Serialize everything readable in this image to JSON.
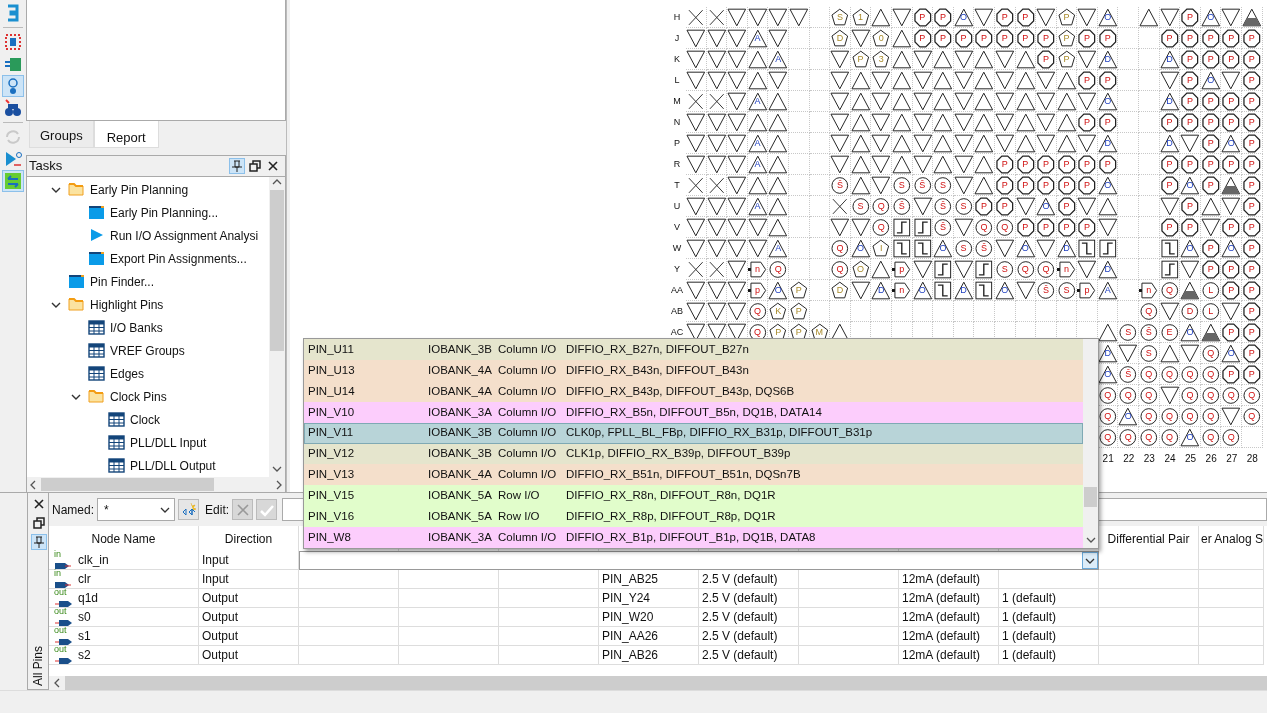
{
  "toolbar": [
    {
      "kind": "bracket",
      "selected": false,
      "disabled": false,
      "separated": false
    },
    {
      "kind": "dotted",
      "selected": false,
      "disabled": false,
      "separated": true
    },
    {
      "kind": "chip",
      "selected": false,
      "disabled": false,
      "separated": false
    },
    {
      "kind": "info",
      "selected": true,
      "disabled": false,
      "separated": false
    },
    {
      "kind": "binoculars",
      "selected": false,
      "disabled": false,
      "separated": false
    },
    {
      "kind": "refresh",
      "selected": false,
      "disabled": true,
      "separated": true
    },
    {
      "kind": "buffer",
      "selected": false,
      "disabled": false,
      "separated": false
    },
    {
      "kind": "swap",
      "selected": true,
      "disabled": false,
      "separated": false
    }
  ],
  "tabs": [
    {
      "label": "Groups",
      "selected": false
    },
    {
      "label": "Report",
      "selected": true
    }
  ],
  "tasks_panel": {
    "title": "Tasks",
    "header_buttons": [
      {
        "kind": "pin",
        "selected": true
      },
      {
        "kind": "restore",
        "selected": false
      },
      {
        "kind": "close",
        "selected": false
      }
    ],
    "tree": [
      {
        "kind": "folder",
        "label": "Early Pin Planning",
        "expanded": true,
        "children": [
          {
            "kind": "window",
            "label": "Early Pin Planning..."
          },
          {
            "kind": "run",
            "label": "Run I/O Assignment Analysi"
          },
          {
            "kind": "window",
            "label": "Export Pin Assignments..."
          }
        ]
      },
      {
        "kind": "window",
        "label": "Pin Finder..."
      },
      {
        "kind": "folder",
        "label": "Highlight Pins",
        "expanded": true,
        "children": [
          {
            "kind": "table",
            "label": "I/O Banks"
          },
          {
            "kind": "table",
            "label": "VREF Groups"
          },
          {
            "kind": "table",
            "label": "Edges"
          },
          {
            "kind": "folder",
            "label": "Clock Pins",
            "expanded": true,
            "children": [
              {
                "kind": "table",
                "label": "Clock"
              },
              {
                "kind": "table",
                "label": "PLL/DLL Input"
              },
              {
                "kind": "table",
                "label": "PLL/DLL Output"
              }
            ]
          }
        ]
      }
    ]
  },
  "package_view": {
    "rows": [
      {
        "label": "H",
        "cells": [
          {
            "kind": "cross"
          },
          {
            "kind": "cross"
          },
          {
            "kind": "down"
          },
          {
            "kind": "down"
          },
          {
            "kind": "down"
          },
          {
            "kind": "down"
          },
          {
            "kind": "empty"
          },
          {
            "kind": "pentagon",
            "code": "S"
          },
          {
            "kind": "pentagon",
            "code": "1"
          },
          {
            "kind": "up"
          },
          {
            "kind": "down"
          },
          {
            "kind": "octagon",
            "code": "P"
          },
          {
            "kind": "octagon",
            "code": "P"
          },
          {
            "kind": "up",
            "code": "O"
          },
          {
            "kind": "down"
          },
          {
            "kind": "octagon",
            "code": "P"
          },
          {
            "kind": "octagon",
            "code": "P"
          },
          {
            "kind": "down"
          },
          {
            "kind": "pentagon",
            "code": "P"
          },
          {
            "kind": "down"
          },
          {
            "kind": "up",
            "code": "O"
          },
          {
            "kind": "empty"
          },
          {
            "kind": "up"
          },
          {
            "kind": "down"
          },
          {
            "kind": "octagon",
            "code": "P"
          },
          {
            "kind": "up",
            "code": "O"
          },
          {
            "kind": "down"
          },
          {
            "kind": "shaded"
          }
        ]
      },
      {
        "label": "J",
        "cells": [
          {
            "kind": "down"
          },
          {
            "kind": "down"
          },
          {
            "kind": "down"
          },
          {
            "kind": "up",
            "code": "A"
          },
          {
            "kind": "down"
          },
          {
            "kind": "empty"
          },
          {
            "kind": "empty"
          },
          {
            "kind": "pentagon",
            "code": "D"
          },
          {
            "kind": "down"
          },
          {
            "kind": "pentagon",
            "code": "0"
          },
          {
            "kind": "up"
          },
          {
            "kind": "octagon",
            "code": "P"
          },
          {
            "kind": "octagon",
            "code": "P"
          },
          {
            "kind": "octagon",
            "code": "P"
          },
          {
            "kind": "octagon",
            "code": "P"
          },
          {
            "kind": "octagon",
            "code": "P"
          },
          {
            "kind": "octagon",
            "code": "P"
          },
          {
            "kind": "octagon",
            "code": "P"
          },
          {
            "kind": "pentagon",
            "code": "P"
          },
          {
            "kind": "octagon",
            "code": "P"
          },
          {
            "kind": "octagon",
            "code": "P"
          },
          {
            "kind": "empty"
          },
          {
            "kind": "empty"
          },
          {
            "kind": "octagon",
            "code": "P"
          },
          {
            "kind": "octagon",
            "code": "P"
          },
          {
            "kind": "octagon",
            "code": "P"
          },
          {
            "kind": "octagon",
            "code": "P"
          },
          {
            "kind": "octagon",
            "code": "P"
          }
        ]
      },
      {
        "label": "K",
        "cells": [
          {
            "kind": "down"
          },
          {
            "kind": "down"
          },
          {
            "kind": "down"
          },
          {
            "kind": "up"
          },
          {
            "kind": "up",
            "code": "A"
          },
          {
            "kind": "empty"
          },
          {
            "kind": "empty"
          },
          {
            "kind": "down"
          },
          {
            "kind": "pentagon",
            "code": "P"
          },
          {
            "kind": "pentagon",
            "code": "3"
          },
          {
            "kind": "up"
          },
          {
            "kind": "down"
          },
          {
            "kind": "up"
          },
          {
            "kind": "down"
          },
          {
            "kind": "up"
          },
          {
            "kind": "down"
          },
          {
            "kind": "up"
          },
          {
            "kind": "octagon",
            "code": "P"
          },
          {
            "kind": "pentagon",
            "code": "P"
          },
          {
            "kind": "down"
          },
          {
            "kind": "up",
            "code": "D"
          },
          {
            "kind": "empty"
          },
          {
            "kind": "empty"
          },
          {
            "kind": "up",
            "code": "D"
          },
          {
            "kind": "octagon",
            "code": "P"
          },
          {
            "kind": "octagon",
            "code": "P"
          },
          {
            "kind": "octagon",
            "code": "P"
          },
          {
            "kind": "octagon",
            "code": "P"
          }
        ]
      },
      {
        "label": "L",
        "cells": [
          {
            "kind": "down"
          },
          {
            "kind": "down"
          },
          {
            "kind": "down"
          },
          {
            "kind": "up"
          },
          {
            "kind": "down"
          },
          {
            "kind": "empty"
          },
          {
            "kind": "empty"
          },
          {
            "kind": "down"
          },
          {
            "kind": "up"
          },
          {
            "kind": "down"
          },
          {
            "kind": "up"
          },
          {
            "kind": "down"
          },
          {
            "kind": "up"
          },
          {
            "kind": "down"
          },
          {
            "kind": "up"
          },
          {
            "kind": "down"
          },
          {
            "kind": "up"
          },
          {
            "kind": "down"
          },
          {
            "kind": "up"
          },
          {
            "kind": "octagon",
            "code": "P"
          },
          {
            "kind": "octagon",
            "code": "P"
          },
          {
            "kind": "empty"
          },
          {
            "kind": "empty"
          },
          {
            "kind": "down"
          },
          {
            "kind": "octagon",
            "code": "P"
          },
          {
            "kind": "up",
            "code": "O"
          },
          {
            "kind": "down"
          },
          {
            "kind": "octagon",
            "code": "P"
          }
        ]
      },
      {
        "label": "M",
        "cells": [
          {
            "kind": "cross"
          },
          {
            "kind": "cross"
          },
          {
            "kind": "down"
          },
          {
            "kind": "up",
            "code": "A"
          },
          {
            "kind": "up"
          },
          {
            "kind": "empty"
          },
          {
            "kind": "empty"
          },
          {
            "kind": "down"
          },
          {
            "kind": "up"
          },
          {
            "kind": "down"
          },
          {
            "kind": "up"
          },
          {
            "kind": "down"
          },
          {
            "kind": "up"
          },
          {
            "kind": "down"
          },
          {
            "kind": "up"
          },
          {
            "kind": "down"
          },
          {
            "kind": "up"
          },
          {
            "kind": "down"
          },
          {
            "kind": "up"
          },
          {
            "kind": "down"
          },
          {
            "kind": "up",
            "code": "O"
          },
          {
            "kind": "empty"
          },
          {
            "kind": "empty"
          },
          {
            "kind": "up",
            "code": "D"
          },
          {
            "kind": "octagon",
            "code": "P"
          },
          {
            "kind": "octagon",
            "code": "P"
          },
          {
            "kind": "octagon",
            "code": "P"
          },
          {
            "kind": "octagon",
            "code": "P"
          }
        ]
      },
      {
        "label": "N",
        "cells": [
          {
            "kind": "down"
          },
          {
            "kind": "down"
          },
          {
            "kind": "down"
          },
          {
            "kind": "up"
          },
          {
            "kind": "up"
          },
          {
            "kind": "empty"
          },
          {
            "kind": "empty"
          },
          {
            "kind": "down"
          },
          {
            "kind": "up"
          },
          {
            "kind": "down"
          },
          {
            "kind": "up"
          },
          {
            "kind": "down"
          },
          {
            "kind": "up"
          },
          {
            "kind": "down"
          },
          {
            "kind": "up"
          },
          {
            "kind": "down"
          },
          {
            "kind": "up"
          },
          {
            "kind": "down"
          },
          {
            "kind": "up"
          },
          {
            "kind": "octagon",
            "code": "P"
          },
          {
            "kind": "octagon",
            "code": "P"
          },
          {
            "kind": "empty"
          },
          {
            "kind": "empty"
          },
          {
            "kind": "octagon",
            "code": "P"
          },
          {
            "kind": "octagon",
            "code": "P"
          },
          {
            "kind": "octagon",
            "code": "P"
          },
          {
            "kind": "octagon",
            "code": "P"
          },
          {
            "kind": "octagon",
            "code": "P"
          }
        ]
      },
      {
        "label": "P",
        "cells": [
          {
            "kind": "down"
          },
          {
            "kind": "down"
          },
          {
            "kind": "down"
          },
          {
            "kind": "up",
            "code": "A"
          },
          {
            "kind": "up"
          },
          {
            "kind": "empty"
          },
          {
            "kind": "empty"
          },
          {
            "kind": "down"
          },
          {
            "kind": "up"
          },
          {
            "kind": "down"
          },
          {
            "kind": "up"
          },
          {
            "kind": "down"
          },
          {
            "kind": "up"
          },
          {
            "kind": "down"
          },
          {
            "kind": "up"
          },
          {
            "kind": "down"
          },
          {
            "kind": "up"
          },
          {
            "kind": "down"
          },
          {
            "kind": "up"
          },
          {
            "kind": "down"
          },
          {
            "kind": "up",
            "code": "D"
          },
          {
            "kind": "empty"
          },
          {
            "kind": "empty"
          },
          {
            "kind": "up",
            "code": "D"
          },
          {
            "kind": "down"
          },
          {
            "kind": "octagon",
            "code": "P"
          },
          {
            "kind": "up",
            "code": "O"
          },
          {
            "kind": "octagon",
            "code": "P"
          }
        ]
      },
      {
        "label": "R",
        "cells": [
          {
            "kind": "down"
          },
          {
            "kind": "down"
          },
          {
            "kind": "down"
          },
          {
            "kind": "up",
            "code": "A"
          },
          {
            "kind": "up"
          },
          {
            "kind": "empty"
          },
          {
            "kind": "empty"
          },
          {
            "kind": "down"
          },
          {
            "kind": "up"
          },
          {
            "kind": "down"
          },
          {
            "kind": "up"
          },
          {
            "kind": "down"
          },
          {
            "kind": "up"
          },
          {
            "kind": "down"
          },
          {
            "kind": "up"
          },
          {
            "kind": "octagon",
            "code": "P"
          },
          {
            "kind": "octagon",
            "code": "P"
          },
          {
            "kind": "octagon",
            "code": "P"
          },
          {
            "kind": "octagon",
            "code": "P"
          },
          {
            "kind": "octagon",
            "code": "P"
          },
          {
            "kind": "octagon",
            "code": "P"
          },
          {
            "kind": "empty"
          },
          {
            "kind": "empty"
          },
          {
            "kind": "octagon",
            "code": "P"
          },
          {
            "kind": "octagon",
            "code": "P"
          },
          {
            "kind": "octagon",
            "code": "P"
          },
          {
            "kind": "octagon",
            "code": "P"
          },
          {
            "kind": "octagon",
            "code": "P"
          }
        ]
      },
      {
        "label": "T",
        "cells": [
          {
            "kind": "cross"
          },
          {
            "kind": "cross"
          },
          {
            "kind": "down"
          },
          {
            "kind": "up"
          },
          {
            "kind": "up"
          },
          {
            "kind": "empty"
          },
          {
            "kind": "empty"
          },
          {
            "kind": "circle",
            "code": "Š"
          },
          {
            "kind": "up"
          },
          {
            "kind": "down"
          },
          {
            "kind": "circle",
            "code": "S"
          },
          {
            "kind": "circle",
            "code": "Š"
          },
          {
            "kind": "circle",
            "code": "S"
          },
          {
            "kind": "down"
          },
          {
            "kind": "up"
          },
          {
            "kind": "octagon",
            "code": "P"
          },
          {
            "kind": "octagon",
            "code": "P"
          },
          {
            "kind": "octagon",
            "code": "P"
          },
          {
            "kind": "octagon",
            "code": "P"
          },
          {
            "kind": "octagon",
            "code": "P"
          },
          {
            "kind": "up",
            "code": "O"
          },
          {
            "kind": "empty"
          },
          {
            "kind": "empty"
          },
          {
            "kind": "octagon",
            "code": "P"
          },
          {
            "kind": "up",
            "code": "O"
          },
          {
            "kind": "octagon",
            "code": "P"
          },
          {
            "kind": "shaded"
          },
          {
            "kind": "octagon",
            "code": "P"
          }
        ]
      },
      {
        "label": "U",
        "cells": [
          {
            "kind": "down"
          },
          {
            "kind": "down"
          },
          {
            "kind": "down"
          },
          {
            "kind": "up",
            "code": "A"
          },
          {
            "kind": "up"
          },
          {
            "kind": "empty"
          },
          {
            "kind": "empty"
          },
          {
            "kind": "cross"
          },
          {
            "kind": "circle",
            "code": "S"
          },
          {
            "kind": "circle",
            "code": "Q"
          },
          {
            "kind": "circle",
            "code": "Š"
          },
          {
            "kind": "down"
          },
          {
            "kind": "circle",
            "code": "Š"
          },
          {
            "kind": "circle",
            "code": "S"
          },
          {
            "kind": "octagon",
            "code": "P"
          },
          {
            "kind": "octagon",
            "code": "P"
          },
          {
            "kind": "down"
          },
          {
            "kind": "up",
            "code": "O"
          },
          {
            "kind": "octagon",
            "code": "P"
          },
          {
            "kind": "down"
          },
          {
            "kind": "up"
          },
          {
            "kind": "empty"
          },
          {
            "kind": "empty"
          },
          {
            "kind": "down"
          },
          {
            "kind": "octagon",
            "code": "P"
          },
          {
            "kind": "up"
          },
          {
            "kind": "down"
          },
          {
            "kind": "octagon",
            "code": "P"
          }
        ]
      },
      {
        "label": "V",
        "cells": [
          {
            "kind": "down"
          },
          {
            "kind": "down"
          },
          {
            "kind": "down"
          },
          {
            "kind": "down"
          },
          {
            "kind": "up"
          },
          {
            "kind": "empty"
          },
          {
            "kind": "empty"
          },
          {
            "kind": "down"
          },
          {
            "kind": "down"
          },
          {
            "kind": "circle",
            "code": "Q"
          },
          {
            "kind": "rise"
          },
          {
            "kind": "rise"
          },
          {
            "kind": "circle",
            "code": "Š"
          },
          {
            "kind": "down"
          },
          {
            "kind": "circle",
            "code": "Q"
          },
          {
            "kind": "circle",
            "code": "Q"
          },
          {
            "kind": "octagon",
            "code": "P"
          },
          {
            "kind": "octagon",
            "code": "P"
          },
          {
            "kind": "octagon",
            "code": "P"
          },
          {
            "kind": "octagon",
            "code": "P"
          },
          {
            "kind": "down"
          },
          {
            "kind": "empty"
          },
          {
            "kind": "empty"
          },
          {
            "kind": "octagon",
            "code": "P"
          },
          {
            "kind": "octagon",
            "code": "P"
          },
          {
            "kind": "down"
          },
          {
            "kind": "octagon",
            "code": "P"
          },
          {
            "kind": "octagon",
            "code": "P"
          }
        ]
      },
      {
        "label": "W",
        "cells": [
          {
            "kind": "down"
          },
          {
            "kind": "down"
          },
          {
            "kind": "down"
          },
          {
            "kind": "down"
          },
          {
            "kind": "up",
            "code": "A"
          },
          {
            "kind": "empty"
          },
          {
            "kind": "empty"
          },
          {
            "kind": "circle",
            "code": "Q"
          },
          {
            "kind": "up",
            "code": "O"
          },
          {
            "kind": "pentagon",
            "code": "I"
          },
          {
            "kind": "fall"
          },
          {
            "kind": "fall"
          },
          {
            "kind": "up",
            "code": "O"
          },
          {
            "kind": "circle",
            "code": "S"
          },
          {
            "kind": "circle",
            "code": "Š"
          },
          {
            "kind": "down"
          },
          {
            "kind": "up",
            "code": "O"
          },
          {
            "kind": "down"
          },
          {
            "kind": "up",
            "code": "D"
          },
          {
            "kind": "fall"
          },
          {
            "kind": "rise"
          },
          {
            "kind": "empty"
          },
          {
            "kind": "empty"
          },
          {
            "kind": "fall"
          },
          {
            "kind": "up",
            "code": "O"
          },
          {
            "kind": "octagon",
            "code": "P"
          },
          {
            "kind": "up",
            "code": "O"
          },
          {
            "kind": "octagon",
            "code": "P"
          }
        ]
      },
      {
        "label": "Y",
        "cells": [
          {
            "kind": "cross"
          },
          {
            "kind": "cross"
          },
          {
            "kind": "down"
          },
          {
            "kind": "flag",
            "code": "n"
          },
          {
            "kind": "circle",
            "code": "Q"
          },
          {
            "kind": "empty"
          },
          {
            "kind": "empty"
          },
          {
            "kind": "circle",
            "code": "Q"
          },
          {
            "kind": "pentagon",
            "code": "O"
          },
          {
            "kind": "up"
          },
          {
            "kind": "flag",
            "code": "p"
          },
          {
            "kind": "down"
          },
          {
            "kind": "rise"
          },
          {
            "kind": "down"
          },
          {
            "kind": "rise"
          },
          {
            "kind": "circle",
            "code": "S"
          },
          {
            "kind": "circle",
            "code": "Q"
          },
          {
            "kind": "circle",
            "code": "Q"
          },
          {
            "kind": "flag",
            "code": "n"
          },
          {
            "kind": "down"
          },
          {
            "kind": "up",
            "code": "D"
          },
          {
            "kind": "empty"
          },
          {
            "kind": "empty"
          },
          {
            "kind": "rise"
          },
          {
            "kind": "down"
          },
          {
            "kind": "octagon",
            "code": "P"
          },
          {
            "kind": "octagon",
            "code": "P"
          },
          {
            "kind": "octagon",
            "code": "P"
          }
        ]
      },
      {
        "label": "AA",
        "cells": [
          {
            "kind": "down"
          },
          {
            "kind": "down"
          },
          {
            "kind": "down"
          },
          {
            "kind": "flag",
            "code": "p"
          },
          {
            "kind": "up",
            "code": "O"
          },
          {
            "kind": "pentagon",
            "code": "P"
          },
          {
            "kind": "empty"
          },
          {
            "kind": "pentagon",
            "code": "D"
          },
          {
            "kind": "down"
          },
          {
            "kind": "up",
            "code": "D"
          },
          {
            "kind": "flag",
            "code": "n"
          },
          {
            "kind": "up",
            "code": "O"
          },
          {
            "kind": "fall"
          },
          {
            "kind": "up",
            "code": "D"
          },
          {
            "kind": "fall"
          },
          {
            "kind": "up",
            "code": "O"
          },
          {
            "kind": "down"
          },
          {
            "kind": "circle",
            "code": "Š"
          },
          {
            "kind": "circle",
            "code": "S"
          },
          {
            "kind": "flag",
            "code": "p"
          },
          {
            "kind": "up",
            "code": "A"
          },
          {
            "kind": "empty"
          },
          {
            "kind": "flag",
            "code": "n"
          },
          {
            "kind": "circle",
            "code": "Q"
          },
          {
            "kind": "shaded"
          },
          {
            "kind": "circle",
            "code": "L"
          },
          {
            "kind": "octagon",
            "code": "P"
          },
          {
            "kind": "octagon",
            "code": "P"
          }
        ]
      },
      {
        "label": "AB",
        "cells": [
          {
            "kind": "down"
          },
          {
            "kind": "down"
          },
          {
            "kind": "down"
          },
          {
            "kind": "circle",
            "code": "Q"
          },
          {
            "kind": "pentagon",
            "code": "K"
          },
          {
            "kind": "pentagon",
            "code": "P"
          },
          {
            "kind": "empty"
          },
          {
            "kind": "empty"
          },
          {
            "kind": "empty"
          },
          {
            "kind": "empty"
          },
          {
            "kind": "empty"
          },
          {
            "kind": "empty"
          },
          {
            "kind": "empty"
          },
          {
            "kind": "empty"
          },
          {
            "kind": "empty"
          },
          {
            "kind": "empty"
          },
          {
            "kind": "empty"
          },
          {
            "kind": "empty"
          },
          {
            "kind": "empty"
          },
          {
            "kind": "empty"
          },
          {
            "kind": "empty"
          },
          {
            "kind": "empty"
          },
          {
            "kind": "circle",
            "code": "Q"
          },
          {
            "kind": "down"
          },
          {
            "kind": "circle",
            "code": "D"
          },
          {
            "kind": "circle",
            "code": "L"
          },
          {
            "kind": "down"
          },
          {
            "kind": "octagon",
            "code": "P"
          }
        ]
      },
      {
        "label": "AC",
        "cells": [
          {
            "kind": "down"
          },
          {
            "kind": "down"
          },
          {
            "kind": "down"
          },
          {
            "kind": "circle",
            "code": "Q"
          },
          {
            "kind": "pentagon",
            "code": "P"
          },
          {
            "kind": "pentagon",
            "code": "P"
          },
          {
            "kind": "pentagon",
            "code": "M"
          },
          {
            "kind": "up"
          },
          {
            "kind": "empty"
          },
          {
            "kind": "empty"
          },
          {
            "kind": "empty"
          },
          {
            "kind": "empty"
          },
          {
            "kind": "empty"
          },
          {
            "kind": "empty"
          },
          {
            "kind": "empty"
          },
          {
            "kind": "empty"
          },
          {
            "kind": "empty"
          },
          {
            "kind": "empty"
          },
          {
            "kind": "empty"
          },
          {
            "kind": "empty"
          },
          {
            "kind": "up"
          },
          {
            "kind": "circle",
            "code": "S"
          },
          {
            "kind": "circle",
            "code": "Š"
          },
          {
            "kind": "circle",
            "code": "E"
          },
          {
            "kind": "up",
            "code": "O"
          },
          {
            "kind": "shaded"
          },
          {
            "kind": "octagon",
            "code": "P"
          },
          {
            "kind": "octagon",
            "code": "P"
          }
        ]
      },
      {
        "cells": [
          {
            "kind": "up",
            "code": "D"
          },
          {
            "kind": "down"
          },
          {
            "kind": "circle",
            "code": "S"
          },
          {
            "kind": "up"
          },
          {
            "kind": "down"
          },
          {
            "kind": "circle",
            "code": "Q"
          },
          {
            "kind": "up",
            "code": "O"
          },
          {
            "kind": "octagon",
            "code": "P"
          }
        ]
      },
      {
        "cells": [
          {
            "kind": "up",
            "code": "O"
          },
          {
            "kind": "circle",
            "code": "Š"
          },
          {
            "kind": "circle",
            "code": "Q"
          },
          {
            "kind": "circle",
            "code": "Q"
          },
          {
            "kind": "circle",
            "code": "Q"
          },
          {
            "kind": "circle",
            "code": "Q"
          },
          {
            "kind": "octagon",
            "code": "P"
          },
          {
            "kind": "octagon",
            "code": "P"
          }
        ]
      },
      {
        "cells": [
          {
            "kind": "circle",
            "code": "Q"
          },
          {
            "kind": "circle",
            "code": "Q"
          },
          {
            "kind": "circle",
            "code": "Q"
          },
          {
            "kind": "down"
          },
          {
            "kind": "circle",
            "code": "Q"
          },
          {
            "kind": "circle",
            "code": "Q"
          },
          {
            "kind": "circle",
            "code": "Q"
          },
          {
            "kind": "circle",
            "code": "Q"
          }
        ]
      },
      {
        "cells": [
          {
            "kind": "circle",
            "code": "Q"
          },
          {
            "kind": "up",
            "code": "O"
          },
          {
            "kind": "circle",
            "code": "Q"
          },
          {
            "kind": "circle",
            "code": "Q"
          },
          {
            "kind": "circle",
            "code": "Q"
          },
          {
            "kind": "circle",
            "code": "Q"
          },
          {
            "kind": "down"
          },
          {
            "kind": "circle",
            "code": "Q"
          }
        ]
      },
      {
        "cells": [
          {
            "kind": "circle",
            "code": "Q"
          },
          {
            "kind": "circle",
            "code": "Q"
          },
          {
            "kind": "circle",
            "code": "Q"
          },
          {
            "kind": "circle",
            "code": "Q"
          },
          {
            "kind": "up",
            "code": "O"
          },
          {
            "kind": "circle",
            "code": "Q"
          },
          {
            "kind": "circle",
            "code": "Q"
          },
          {
            "kind": "empty"
          }
        ]
      }
    ],
    "column_labels": [
      "21",
      "22",
      "23",
      "24",
      "25",
      "26",
      "27",
      "28"
    ]
  },
  "pins_panel": {
    "side_tab": "All Pins",
    "side_buttons": [
      {
        "kind": "close",
        "selected": false
      },
      {
        "kind": "restore",
        "selected": false
      },
      {
        "kind": "pin",
        "selected": true
      }
    ],
    "named_label": "Named:",
    "named_value": "*",
    "edit_label": "Edit:",
    "edit_buttons": [
      {
        "kind": "cancel",
        "disabled": true
      },
      {
        "kind": "accept",
        "disabled": true
      }
    ],
    "columns": [
      "Node Name",
      "Direction"
    ],
    "right_columns": [
      "Differential Pair",
      "er Analog S"
    ],
    "rows": [
      {
        "kind": "input",
        "tag": "in",
        "node_name": "clk_in",
        "direction": "Input",
        "editing": true
      },
      {
        "kind": "input",
        "tag": "in",
        "node_name": "clr",
        "direction": "Input",
        "editing": false,
        "column_6": "PIN_AB25",
        "column_7": "2.5 V (default)",
        "column_9": "12mA (default)"
      },
      {
        "kind": "output",
        "tag": "out",
        "node_name": "q1d",
        "direction": "Output",
        "editing": false,
        "column_6": "PIN_Y24",
        "column_7": "2.5 V (default)",
        "column_9": "12mA (default)",
        "column_10": "1 (default)"
      },
      {
        "kind": "output",
        "tag": "out",
        "node_name": "s0",
        "direction": "Output",
        "editing": false,
        "column_6": "PIN_W20",
        "column_7": "2.5 V (default)",
        "column_9": "12mA (default)",
        "column_10": "1 (default)"
      },
      {
        "kind": "output",
        "tag": "out",
        "node_name": "s1",
        "direction": "Output",
        "editing": false,
        "column_6": "PIN_AA26",
        "column_7": "2.5 V (default)",
        "column_9": "12mA (default)",
        "column_10": "1 (default)"
      },
      {
        "kind": "output",
        "tag": "out",
        "node_name": "s2",
        "direction": "Output",
        "editing": false,
        "column_6": "PIN_AB26",
        "column_7": "2.5 V (default)",
        "column_9": "12mA (default)",
        "column_10": "1 (default)"
      }
    ]
  },
  "location_dropdown": {
    "options": [
      {
        "pin": "PIN_U11",
        "bank": "IOBANK_3B",
        "type": "Column I/O",
        "functions": "DIFFIO_RX_B27n, DIFFOUT_B27n",
        "color": "#e5e5cd",
        "selected": false
      },
      {
        "pin": "PIN_U13",
        "bank": "IOBANK_4A",
        "type": "Column I/O",
        "functions": "DIFFIO_RX_B43n, DIFFOUT_B43n",
        "color": "#f4dfcb",
        "selected": false
      },
      {
        "pin": "PIN_U14",
        "bank": "IOBANK_4A",
        "type": "Column I/O",
        "functions": "DIFFIO_RX_B43p, DIFFOUT_B43p, DQS6B",
        "color": "#f4dfcb",
        "selected": false
      },
      {
        "pin": "PIN_V10",
        "bank": "IOBANK_3A",
        "type": "Column I/O",
        "functions": "DIFFIO_RX_B5n, DIFFOUT_B5n, DQ1B, DATA14",
        "color": "#fccdfc",
        "selected": false
      },
      {
        "pin": "PIN_V11",
        "bank": "IOBANK_3B",
        "type": "Column I/O",
        "functions": "CLK0p, FPLL_BL_FBp, DIFFIO_RX_B31p, DIFFOUT_B31p",
        "selected": true
      },
      {
        "pin": "PIN_V12",
        "bank": "IOBANK_3B",
        "type": "Column I/O",
        "functions": "CLK1p, DIFFIO_RX_B39p, DIFFOUT_B39p",
        "color": "#e5e5cd",
        "selected": false
      },
      {
        "pin": "PIN_V13",
        "bank": "IOBANK_4A",
        "type": "Column I/O",
        "functions": "DIFFIO_RX_B51n, DIFFOUT_B51n, DQSn7B",
        "color": "#f4dfcb",
        "selected": false
      },
      {
        "pin": "PIN_V15",
        "bank": "IOBANK_5A",
        "type": "Row I/O",
        "functions": "DIFFIO_RX_R8n, DIFFOUT_R8n, DQ1R",
        "color": "#e1fdcb",
        "selected": false
      },
      {
        "pin": "PIN_V16",
        "bank": "IOBANK_5A",
        "type": "Row I/O",
        "functions": "DIFFIO_RX_R8p, DIFFOUT_R8p, DQ1R",
        "color": "#e1fdcb",
        "selected": false
      },
      {
        "pin": "PIN_W8",
        "bank": "IOBANK_3A",
        "type": "Column I/O",
        "functions": "DIFFIO_RX_B1p, DIFFOUT_B1p, DQ1B, DATA8",
        "color": "#fccdfc",
        "selected": false
      }
    ]
  }
}
